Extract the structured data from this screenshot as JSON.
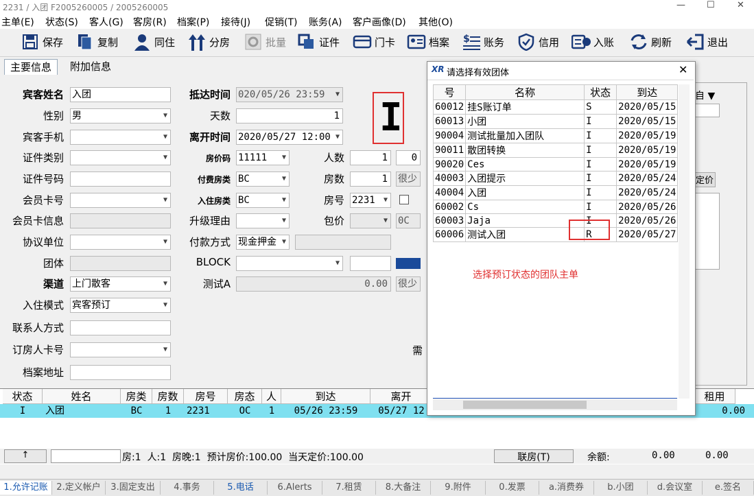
{
  "window": {
    "title": "2231 / 入团 F2005260005 / 2005260005",
    "min": "—",
    "max": "☐",
    "close": "✕"
  },
  "menu": [
    "主单(E)",
    "状态(S)",
    "客人(G)",
    "客房(R)",
    "档案(P)",
    "接待(J)",
    "促销(T)",
    "账务(A)",
    "客户画像(D)",
    "其他(O)"
  ],
  "toolbar": {
    "save": "保存",
    "copy": "复制",
    "cohabit": "同住",
    "split": "分房",
    "batch": "批量",
    "cert": "证件",
    "doorcard": "门卡",
    "profile": "档案",
    "accounts": "账务",
    "credit": "信用",
    "post": "入账",
    "refresh": "刷新",
    "exit": "退出"
  },
  "tabs": {
    "main": "主要信息",
    "extra": "附加信息"
  },
  "form": {
    "guest_name_label": "宾客姓名",
    "guest_name": "入团",
    "gender_label": "性别",
    "gender": "男",
    "phone_label": "宾客手机",
    "phone": "",
    "cert_type_label": "证件类别",
    "cert_type": "",
    "cert_no_label": "证件号码",
    "cert_no": "",
    "member_card_label": "会员卡号",
    "member_card": "",
    "member_info_label": "会员卡信息",
    "member_info": "",
    "agreement_label": "协议单位",
    "agreement": "",
    "group_label": "团体",
    "group": "",
    "channel_label": "渠道",
    "channel": "上门散客",
    "mode_label": "入住模式",
    "mode": "宾客预订",
    "contact_label": "联系人方式",
    "contact": "",
    "booker_card_label": "订房人卡号",
    "booker_card": "",
    "address_label": "档案地址",
    "address": "",
    "arrive_label": "抵达时间",
    "arrive": "020/05/26 23:59",
    "days_label": "天数",
    "days": "1",
    "leave_label": "离开时间",
    "leave": "2020/05/27 12:00",
    "rate_code_label": "房价码",
    "rate_code": "11111",
    "pay_room_label": "付费房类",
    "pay_room": "BC",
    "stay_room_label": "入住房类",
    "stay_room": "BC",
    "upgrade_label": "升级理由",
    "upgrade": "",
    "pay_method_label": "付款方式",
    "pay_method": "现金押金",
    "block_label": "BLOCK",
    "block": "",
    "test_label": "测试A",
    "test_value": "0.00",
    "persons_label": "人数",
    "persons": "1",
    "persons2": "0",
    "rooms_label": "房数",
    "rooms": "1",
    "room_no_label": "房号",
    "room_no": "2231",
    "package_label": "包价",
    "oc": "0C",
    "few1": "很少",
    "few2": "很少",
    "cursor_char": "I",
    "need_label": "需"
  },
  "dialog": {
    "title": "请选择有效团体",
    "columns": [
      "号",
      "名称",
      "状态",
      "到达"
    ],
    "rows": [
      [
        "60012",
        "挂S账订单",
        "S",
        "2020/05/15"
      ],
      [
        "60013",
        "小团",
        "I",
        "2020/05/15"
      ],
      [
        "90004",
        "测试批量加入团队",
        "I",
        "2020/05/19"
      ],
      [
        "90011",
        "散团转换",
        "I",
        "2020/05/19"
      ],
      [
        "90020",
        "Ces",
        "I",
        "2020/05/19"
      ],
      [
        "40003",
        "入团提示",
        "I",
        "2020/05/24"
      ],
      [
        "40004",
        "入团",
        "I",
        "2020/05/24"
      ],
      [
        "60002",
        "Cs",
        "I",
        "2020/05/26"
      ],
      [
        "60003",
        "Jaja",
        "I",
        "2020/05/26"
      ],
      [
        "60006",
        "测试入团",
        "R",
        "2020/05/27"
      ]
    ],
    "annotation": "选择预订状态的团队主单",
    "annotation_color": "#e03030"
  },
  "grid": {
    "columns": [
      "状态",
      "姓名",
      "房类",
      "房数",
      "房号",
      "房态",
      "人",
      "到达",
      "离开"
    ],
    "row": [
      "I",
      "入团",
      "BC",
      "1",
      "2231",
      "OC",
      "1",
      "05/26 23:59",
      "05/27 12"
    ],
    "right_col": "租用",
    "right_val": "0.00"
  },
  "summary": {
    "up": "↑",
    "text": "房:1  人:1  房晚:1  预计房价:100.00  当天定价:100.00",
    "link_room": "联房(T)",
    "balance_label": "余额:",
    "balance": "0.00",
    "balance2": "0.00"
  },
  "right_panel": {
    "col": "自 ▼",
    "price": "定价"
  },
  "bottom_tabs": [
    "1.允许记账",
    "2.定义帐户",
    "3.固定支出",
    "4.事务",
    "5.电话",
    "6.Alerts",
    "7.租赁",
    "8.大备注",
    "9.附件",
    "0.发票",
    "a.消费券",
    "b.小团",
    "d.会议室",
    "e.签名"
  ]
}
